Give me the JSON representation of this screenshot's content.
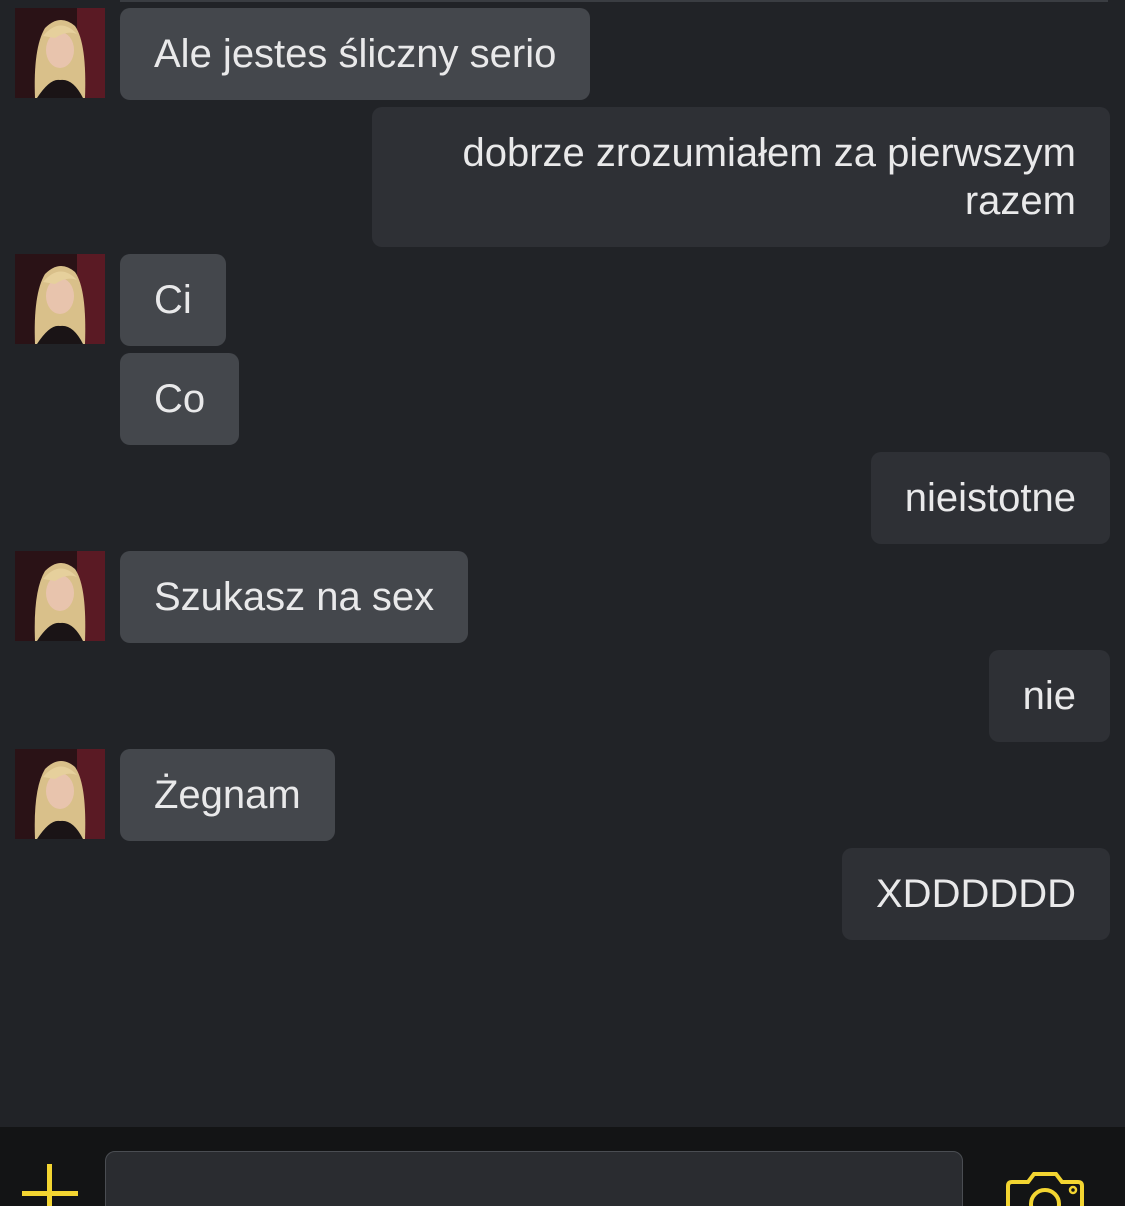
{
  "conversation": {
    "messages": [
      {
        "sender": "contact",
        "text": "Ale jestes śliczny serio"
      },
      {
        "sender": "me",
        "text": "dobrze zrozumiałem za pierwszym razem"
      },
      {
        "sender": "contact",
        "text": "Ci"
      },
      {
        "sender": "contact",
        "text": "Co"
      },
      {
        "sender": "me",
        "text": "nieistotne"
      },
      {
        "sender": "contact",
        "text": "Szukasz na sex"
      },
      {
        "sender": "me",
        "text": "nie"
      },
      {
        "sender": "contact",
        "text": "Żegnam"
      },
      {
        "sender": "me",
        "text": "XDDDDDD"
      }
    ]
  },
  "composer": {
    "input_value": "",
    "input_placeholder": "",
    "plus_icon": "plus-icon",
    "camera_icon": "camera-icon"
  },
  "colors": {
    "background": "#212327",
    "incoming_bubble": "#44474c",
    "outgoing_bubble": "#2e3035",
    "text": "#e9e9ea",
    "accent": "#f3d531",
    "composer_bar": "#131415"
  }
}
